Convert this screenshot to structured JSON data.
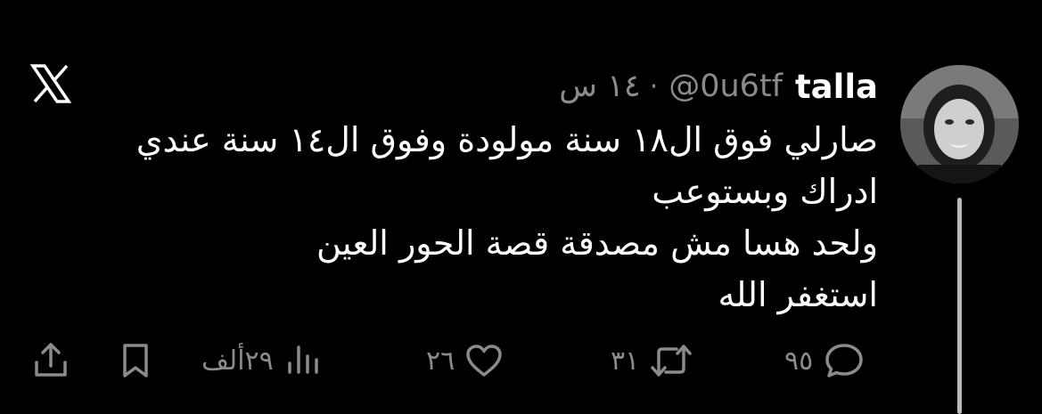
{
  "tweet": {
    "display_name": "talla",
    "handle": "@0u6tf",
    "separator": "·",
    "time": "١٤ س",
    "text_lines": [
      "صارلي فوق ال١٨ سنة مولودة وفوق ال١٤ سنة عندي",
      "ادراك وبستوعب",
      "ولحد هسا مش مصدقة قصة الحور العين",
      "استغفر الله"
    ]
  },
  "actions": {
    "replies": "٩٥",
    "retweets": "٣١",
    "likes": "٢٦",
    "views": "٢٩ألف"
  },
  "icons": {
    "logo": "x-logo-icon",
    "reply": "reply-icon",
    "retweet": "retweet-icon",
    "like": "heart-icon",
    "views": "views-chart-icon",
    "bookmark": "bookmark-icon",
    "share": "share-icon"
  },
  "colors": {
    "background": "#000000",
    "text": "#ffffff",
    "muted": "#8b8b8b",
    "thread_line": "#b9b9b9"
  }
}
